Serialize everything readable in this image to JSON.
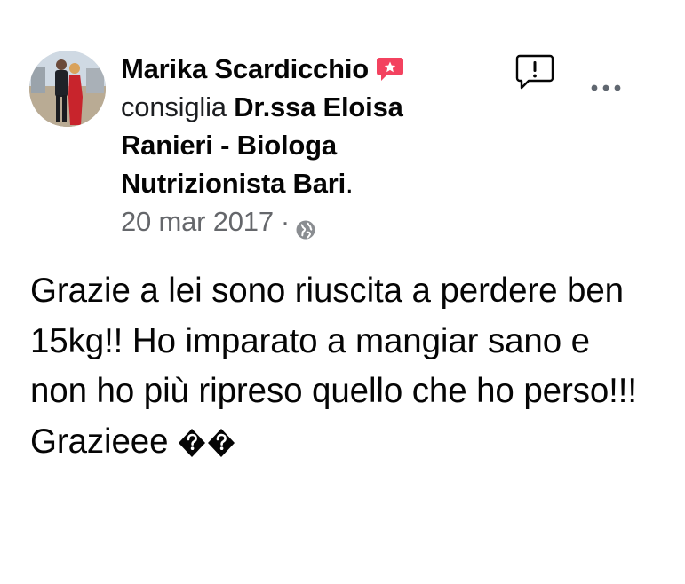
{
  "post": {
    "author_name": "Marika Scardicchio",
    "recommend_verb": "consiglia",
    "page_name": "Dr.ssa Eloisa Ranieri - Biologa Nutrizionista Bari",
    "page_name_suffix": ".",
    "date": "20 mar 2017",
    "separator": "·",
    "body_text": "Grazie a lei sono riuscita a perdere ben 15kg!! Ho imparato a mangiar sano e non ho più ripreso quello che ho perso!!!",
    "closing_text": "Grazieee"
  },
  "icons": {
    "recommend_badge": "recommend-badge-icon",
    "globe": "globe-icon",
    "report": "report-icon",
    "more": "more-options-icon",
    "replacement_chars": "replacement-character-icon"
  },
  "colors": {
    "text": "#050505",
    "secondary_text": "#65676b",
    "recommend_badge": "#f3425f"
  }
}
